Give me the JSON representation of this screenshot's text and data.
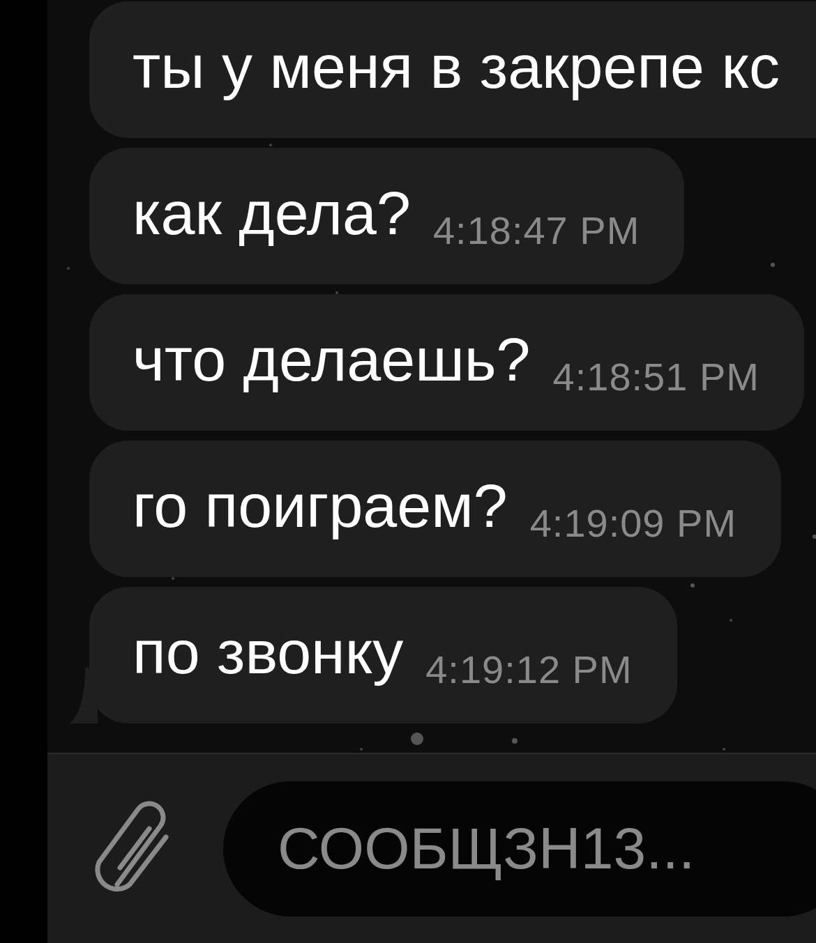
{
  "messages": [
    {
      "text": "ты у меня в закрепе кс",
      "tail": false
    },
    {
      "text": "как дела?",
      "time": "4:18:47 PM",
      "tail": false
    },
    {
      "text": "что делаешь?",
      "time": "4:18:51 PM",
      "tail": false
    },
    {
      "text": "го поиграем?",
      "time": "4:19:09 PM",
      "tail": false
    },
    {
      "text": "по звонку",
      "time": "4:19:12 PM",
      "tail": true
    }
  ],
  "composer": {
    "placeholder": "СООБЩЗН13..."
  }
}
